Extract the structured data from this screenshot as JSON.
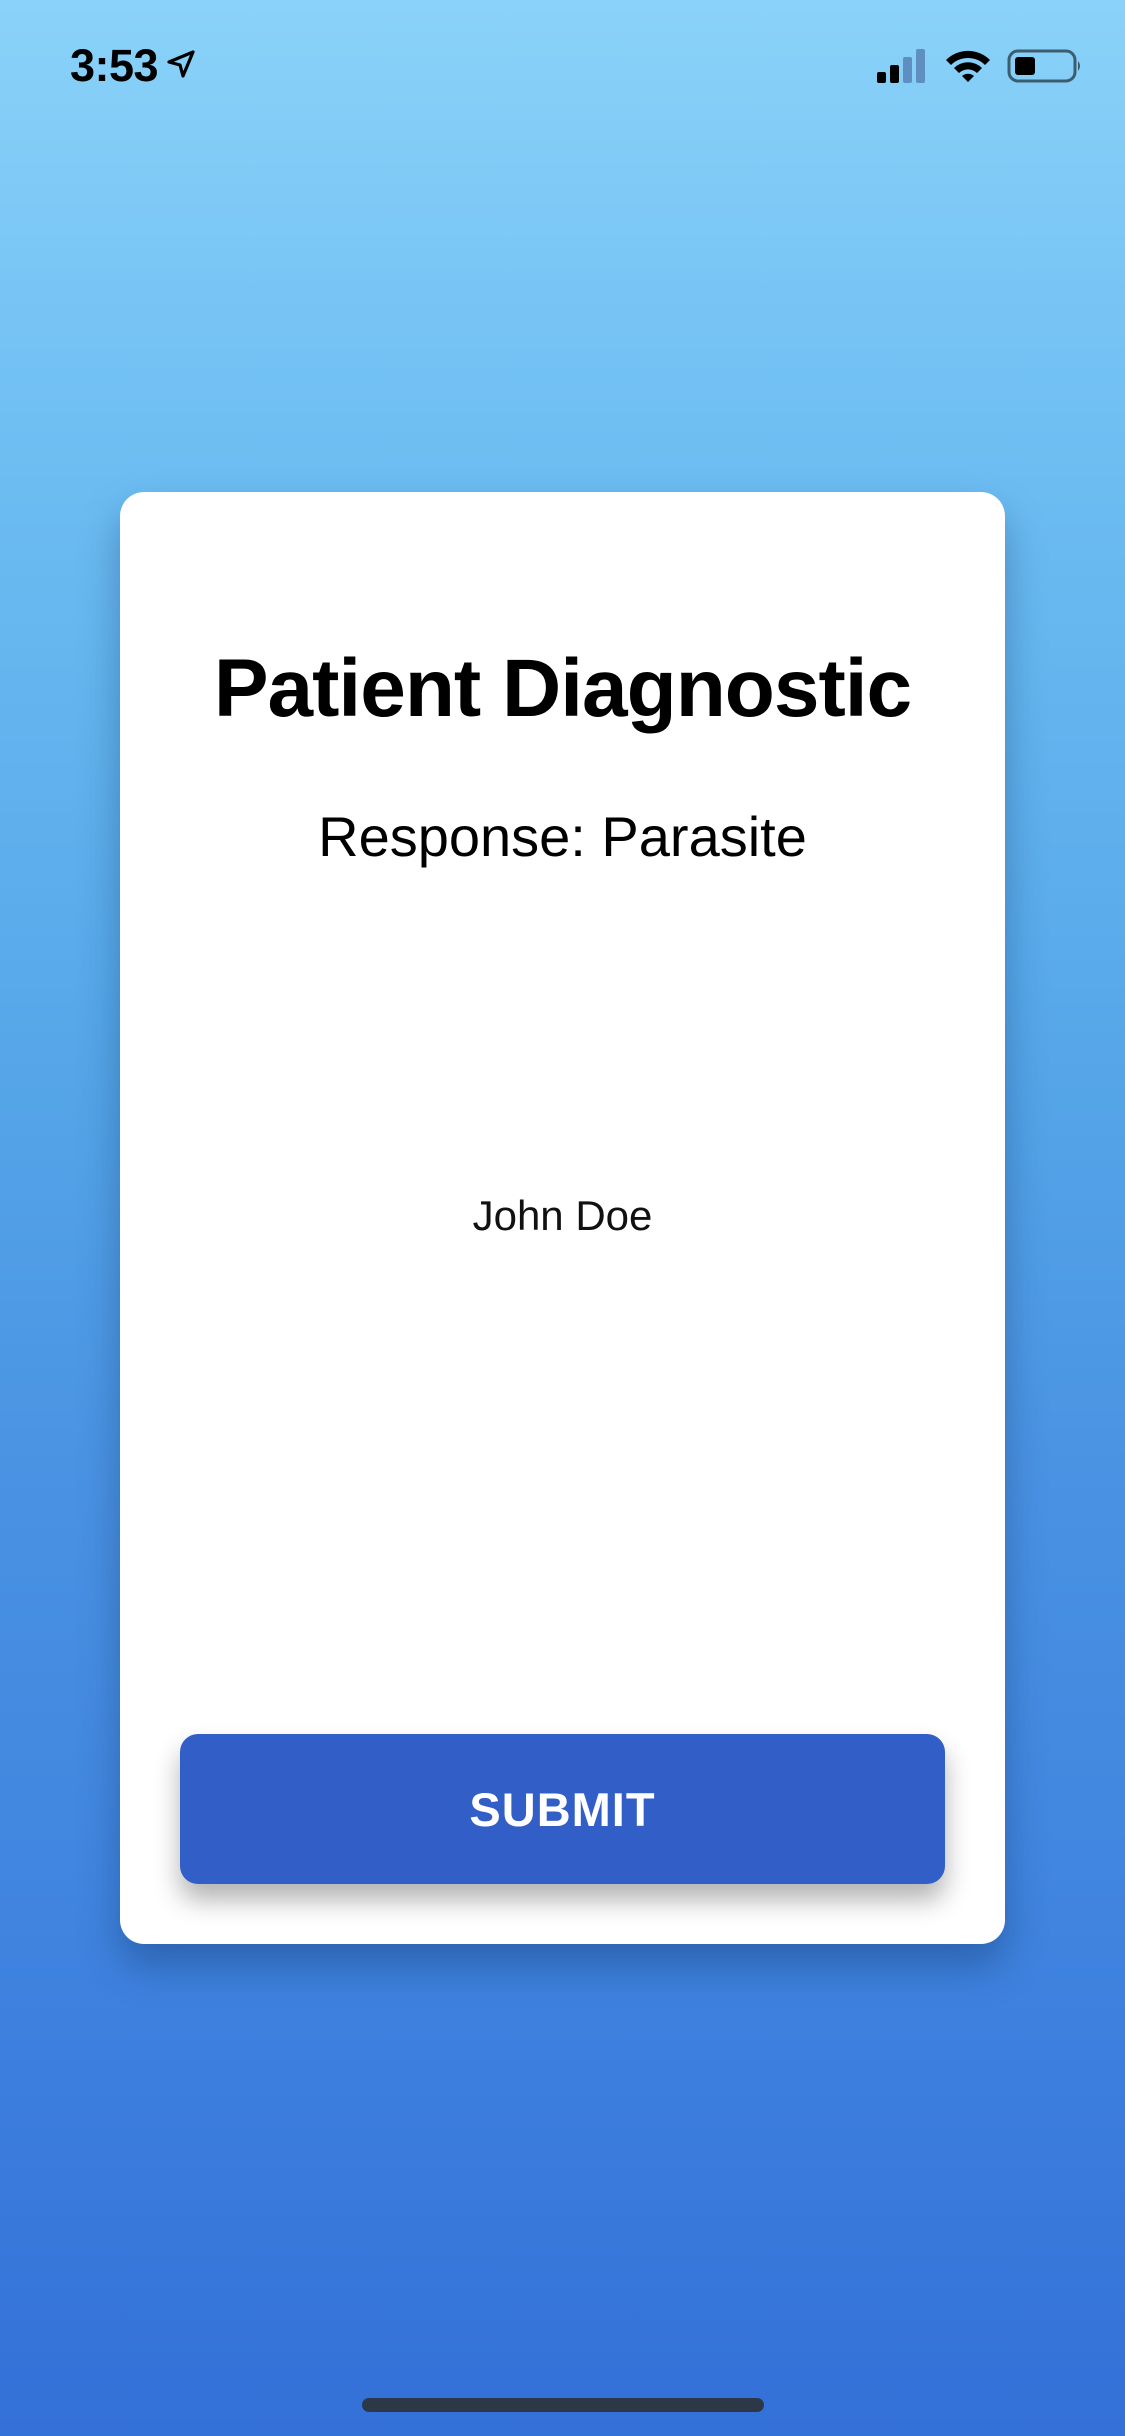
{
  "status_bar": {
    "time": "3:53",
    "icons": [
      "location-arrow-icon",
      "cellular-signal-icon",
      "wifi-icon",
      "battery-icon"
    ]
  },
  "colors": {
    "background_gradient_top": "#8ad2f9",
    "background_gradient_bottom": "#3370d8",
    "card_background": "#ffffff",
    "button_background": "#325fc7",
    "button_text": "#ffffff"
  },
  "card": {
    "title": "Patient Diagnostic",
    "response": "Response: Parasite",
    "patient_name": "John Doe",
    "submit_label": "SUBMIT"
  }
}
